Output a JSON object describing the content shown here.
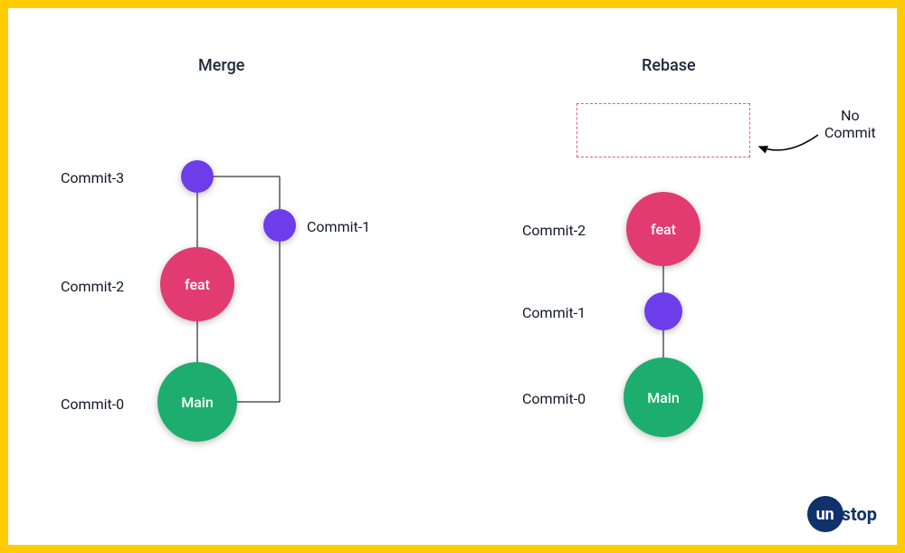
{
  "titles": {
    "merge": "Merge",
    "rebase": "Rebase"
  },
  "merge": {
    "labels": {
      "commit0": "Commit-0",
      "commit1": "Commit-1",
      "commit2": "Commit-2",
      "commit3": "Commit-3"
    },
    "nodes": {
      "main": "Main",
      "feat": "feat"
    }
  },
  "rebase": {
    "labels": {
      "commit0": "Commit-0",
      "commit1": "Commit-1",
      "commit2": "Commit-2",
      "noCommit": "No\nCommit"
    },
    "nodes": {
      "main": "Main",
      "feat": "feat"
    }
  },
  "logo": {
    "ball": "un",
    "rest": "stop"
  },
  "colors": {
    "purple": "#6C3DE8",
    "pink": "#E13B72",
    "green": "#1DAD6F",
    "frame": "#FFCC01",
    "dash": "#e45a8a",
    "logoNavy": "#10316b"
  }
}
